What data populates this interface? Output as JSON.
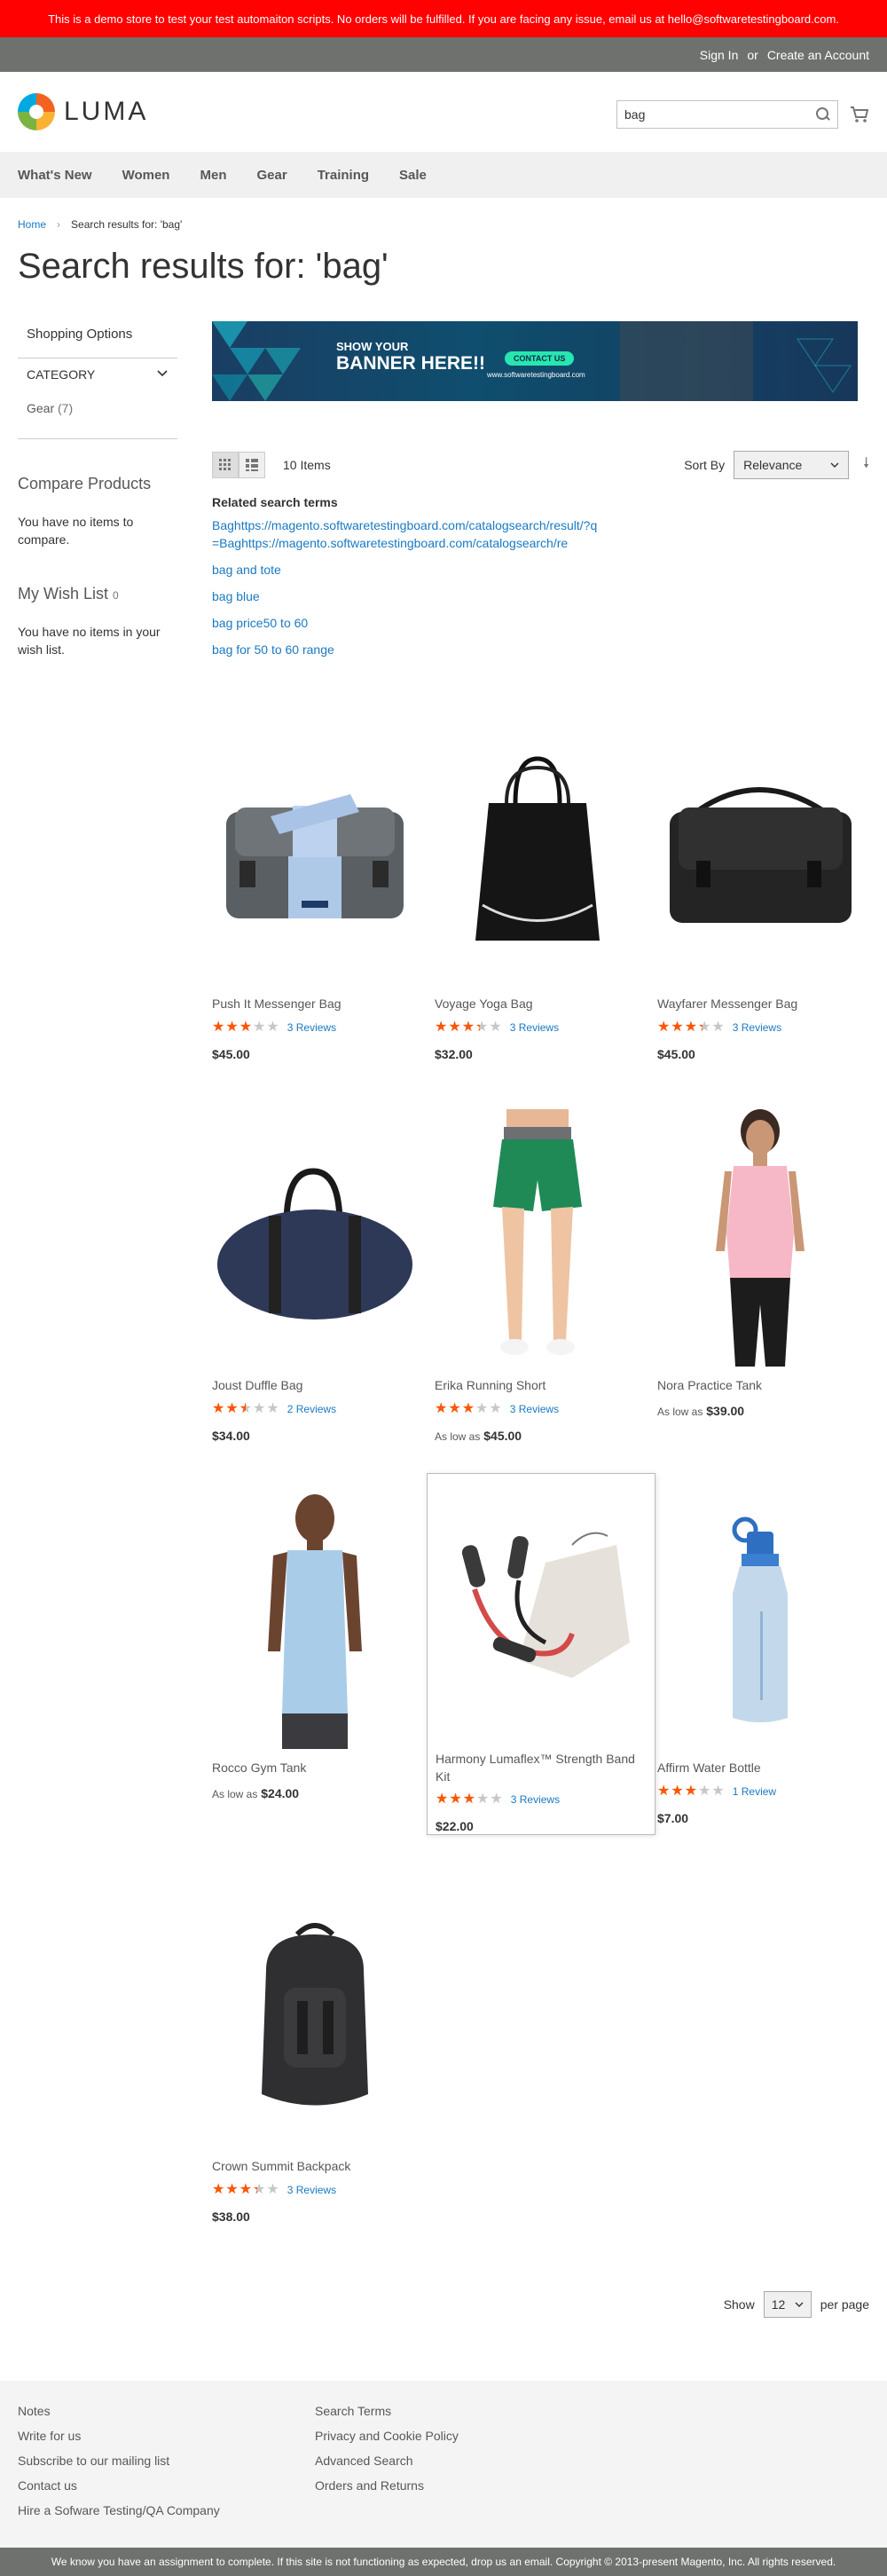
{
  "demo_notice": "This is a demo store to test your test automaiton scripts. No orders will be fulfilled. If you are facing any issue, email us at hello@softwaretestingboard.com.",
  "top_links": {
    "sign_in": "Sign In",
    "or": "or",
    "create": "Create an Account"
  },
  "logo_text": "LUMA",
  "search": {
    "value": "bag"
  },
  "nav": [
    "What's New",
    "Women",
    "Men",
    "Gear",
    "Training",
    "Sale"
  ],
  "breadcrumb": {
    "home": "Home",
    "current": "Search results for: 'bag'"
  },
  "title": "Search results for: 'bag'",
  "sidebar": {
    "shopping_options": "Shopping Options",
    "category_title": "CATEGORY",
    "category_item": "Gear",
    "category_count": "(7)",
    "compare_title": "Compare Products",
    "compare_text": "You have no items to compare.",
    "wishlist_title": "My Wish List",
    "wishlist_count": "0",
    "wishlist_text": "You have no items in your wish list."
  },
  "banner": {
    "line1": "SHOW YOUR",
    "line2": "BANNER HERE!!",
    "cta": "CONTACT US",
    "url": "www.softwaretestingboard.com"
  },
  "toolbar": {
    "amount": "10 Items",
    "sort_label": "Sort By",
    "sort_value": "Relevance"
  },
  "related": {
    "title": "Related search terms",
    "terms": [
      "Baghttps://magento.softwaretestingboard.com/catalogsearch/result/?q=Baghttps://magento.softwaretestingboard.com/catalogsearch/re",
      "bag and tote",
      "bag blue",
      "bag price50 to 60",
      "bag for 50 to 60 range"
    ]
  },
  "products": [
    {
      "name": "Push It Messenger Bag",
      "rating": 0.6,
      "reviews": "3 Reviews",
      "price_prefix": "",
      "price": "$45.00"
    },
    {
      "name": "Voyage Yoga Bag",
      "rating": 0.67,
      "reviews": "3 Reviews",
      "price_prefix": "",
      "price": "$32.00"
    },
    {
      "name": "Wayfarer Messenger Bag",
      "rating": 0.67,
      "reviews": "3 Reviews",
      "price_prefix": "",
      "price": "$45.00"
    },
    {
      "name": "Joust Duffle Bag",
      "rating": 0.5,
      "reviews": "2 Reviews",
      "price_prefix": "",
      "price": "$34.00"
    },
    {
      "name": "Erika Running Short",
      "rating": 0.6,
      "reviews": "3 Reviews",
      "price_prefix": "As low as",
      "price": "$45.00"
    },
    {
      "name": "Nora Practice Tank",
      "rating": null,
      "reviews": "",
      "price_prefix": "As low as",
      "price": "$39.00"
    },
    {
      "name": "Rocco Gym Tank",
      "rating": null,
      "reviews": "",
      "price_prefix": "As low as",
      "price": "$24.00"
    },
    {
      "name": "Harmony Lumaflex™ Strength Band Kit",
      "rating": 0.6,
      "reviews": "3 Reviews",
      "price_prefix": "",
      "price": "$22.00"
    },
    {
      "name": "Affirm Water Bottle",
      "rating": 0.6,
      "reviews": "1 Review",
      "price_prefix": "",
      "price": "$7.00"
    },
    {
      "name": "Crown Summit Backpack",
      "rating": 0.67,
      "reviews": "3 Reviews",
      "price_prefix": "",
      "price": "$38.00"
    }
  ],
  "pager": {
    "show": "Show",
    "limit": "12",
    "per_page": "per page"
  },
  "footer": {
    "col1": [
      "Notes",
      "Write for us",
      "Subscribe to our mailing list",
      "Contact us",
      "Hire a Sofware Testing/QA Company"
    ],
    "col2": [
      "Search Terms",
      "Privacy and Cookie Policy",
      "Advanced Search",
      "Orders and Returns"
    ]
  },
  "copyright": "We know you have an assignment to complete. If this site is not functioning as expected, drop us an email. Copyright © 2013-present Magento, Inc. All rights reserved.",
  "colors": {
    "demo_bar": "#ff0101",
    "link": "#1979c3",
    "star": "#ff5501",
    "nav_bg": "#f0f0f0",
    "footer_bg": "#f4f4f4"
  }
}
